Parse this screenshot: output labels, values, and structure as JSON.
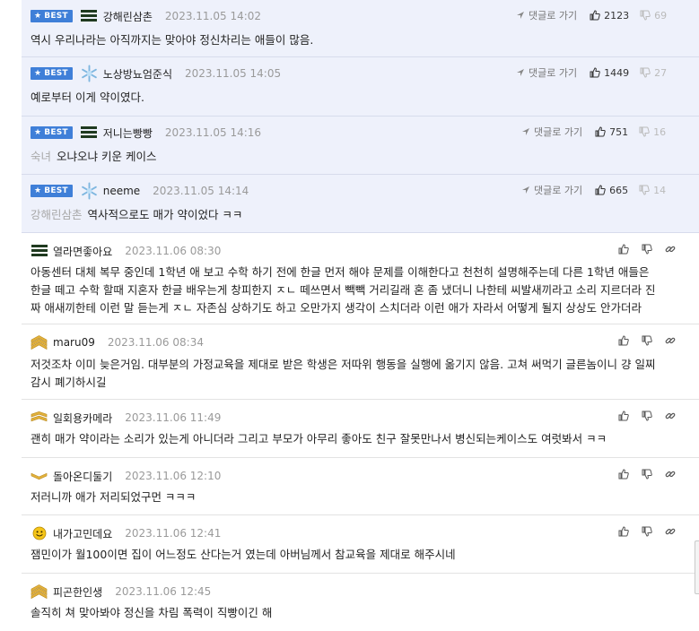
{
  "labels": {
    "best": "BEST",
    "reply": "댓글로 가기"
  },
  "best_comments": [
    {
      "nick": "강해린삼촌",
      "date": "2023.11.05 14:02",
      "up": "2123",
      "down": "69",
      "mention": "",
      "text": "역시 우리나라는 아직까지는 맞아야 정신차리는 애들이 많음.",
      "level_icon": "stripes-icon"
    },
    {
      "nick": "노상방뇨엄준식",
      "date": "2023.11.05 14:05",
      "up": "1449",
      "down": "27",
      "mention": "",
      "text": "예로부터 이게 약이였다.",
      "level_icon": "snowflake-icon"
    },
    {
      "nick": "저니는빵빵",
      "date": "2023.11.05 14:16",
      "up": "751",
      "down": "16",
      "mention": "숙녀",
      "text": "오냐오냐 키운 케이스",
      "level_icon": "stripes-icon"
    },
    {
      "nick": "neeme",
      "date": "2023.11.05 14:14",
      "up": "665",
      "down": "14",
      "mention": "강해린삼촌",
      "text": "역사적으로도 매가 약이었다 ㅋㅋ",
      "level_icon": "snowflake-icon"
    }
  ],
  "comments": [
    {
      "nick": "열라면좋아요",
      "date": "2023.11.06 08:30",
      "lines": [
        "아동센터 대체 복무 중인데 1학년 애 보고 수학 하기 전에 한글 먼저 해야 문제를 이해한다고 천천히 설명해주는데 다른 1학년 애들은",
        "한글 떼고 수학 할때 지혼자 한글 배우는게 창피한지 ㅈㄴ 떼쓰면서 빽빽 거리길래 혼 좀 냈더니 나한테 씨발새끼라고 소리 지르더라 진",
        "짜 애새끼한테 이런 말 듣는게 ㅈㄴ 자존심 상하기도 하고 오만가지 생각이 스치더라 이런 애가 자라서 어떻게 될지 상상도 안가더라"
      ],
      "level_icon": "stripes-icon"
    },
    {
      "nick": "maru09",
      "date": "2023.11.06 08:34",
      "lines": [
        "저것조차 이미 늦은거임. 대부분의 가정교육을 제대로 받은 학생은 저따위 행동을 실행에 옮기지 않음. 고쳐 써먹기 글른놈이니 걍 일찌",
        "감시 폐기하시길"
      ],
      "level_icon": "gold-chevron-icon"
    },
    {
      "nick": "일회용카메라",
      "date": "2023.11.06 11:49",
      "lines": [
        "괜히 매가 약이라는 소리가 있는게 아니더라 그리고 부모가 아무리 좋아도 친구 잘못만나서 병신되는케이스도 여럿봐서 ㅋㅋ"
      ],
      "level_icon": "gold-chevron-icon"
    },
    {
      "nick": "돌아온디둘기",
      "date": "2023.11.06 12:10",
      "lines": [
        "저러니까 애가 저리되었구먼 ㅋㅋㅋ"
      ],
      "level_icon": "gold-chevron-icon"
    },
    {
      "nick": "내가고민데요",
      "date": "2023.11.06 12:41",
      "lines": [
        "잼민이가 월100이면 집이 어느정도 산다는거 였는데 아버님께서 참교육을 제대로 해주시네"
      ],
      "level_icon": "smiley-icon"
    },
    {
      "nick": "피곤한인생",
      "date": "2023.11.06 12:45",
      "lines": [
        "솔직히 쳐 맞아봐야 정신을 차림 폭력이 직빵이긴 해"
      ],
      "level_icon": "gold-chevron-icon"
    }
  ]
}
